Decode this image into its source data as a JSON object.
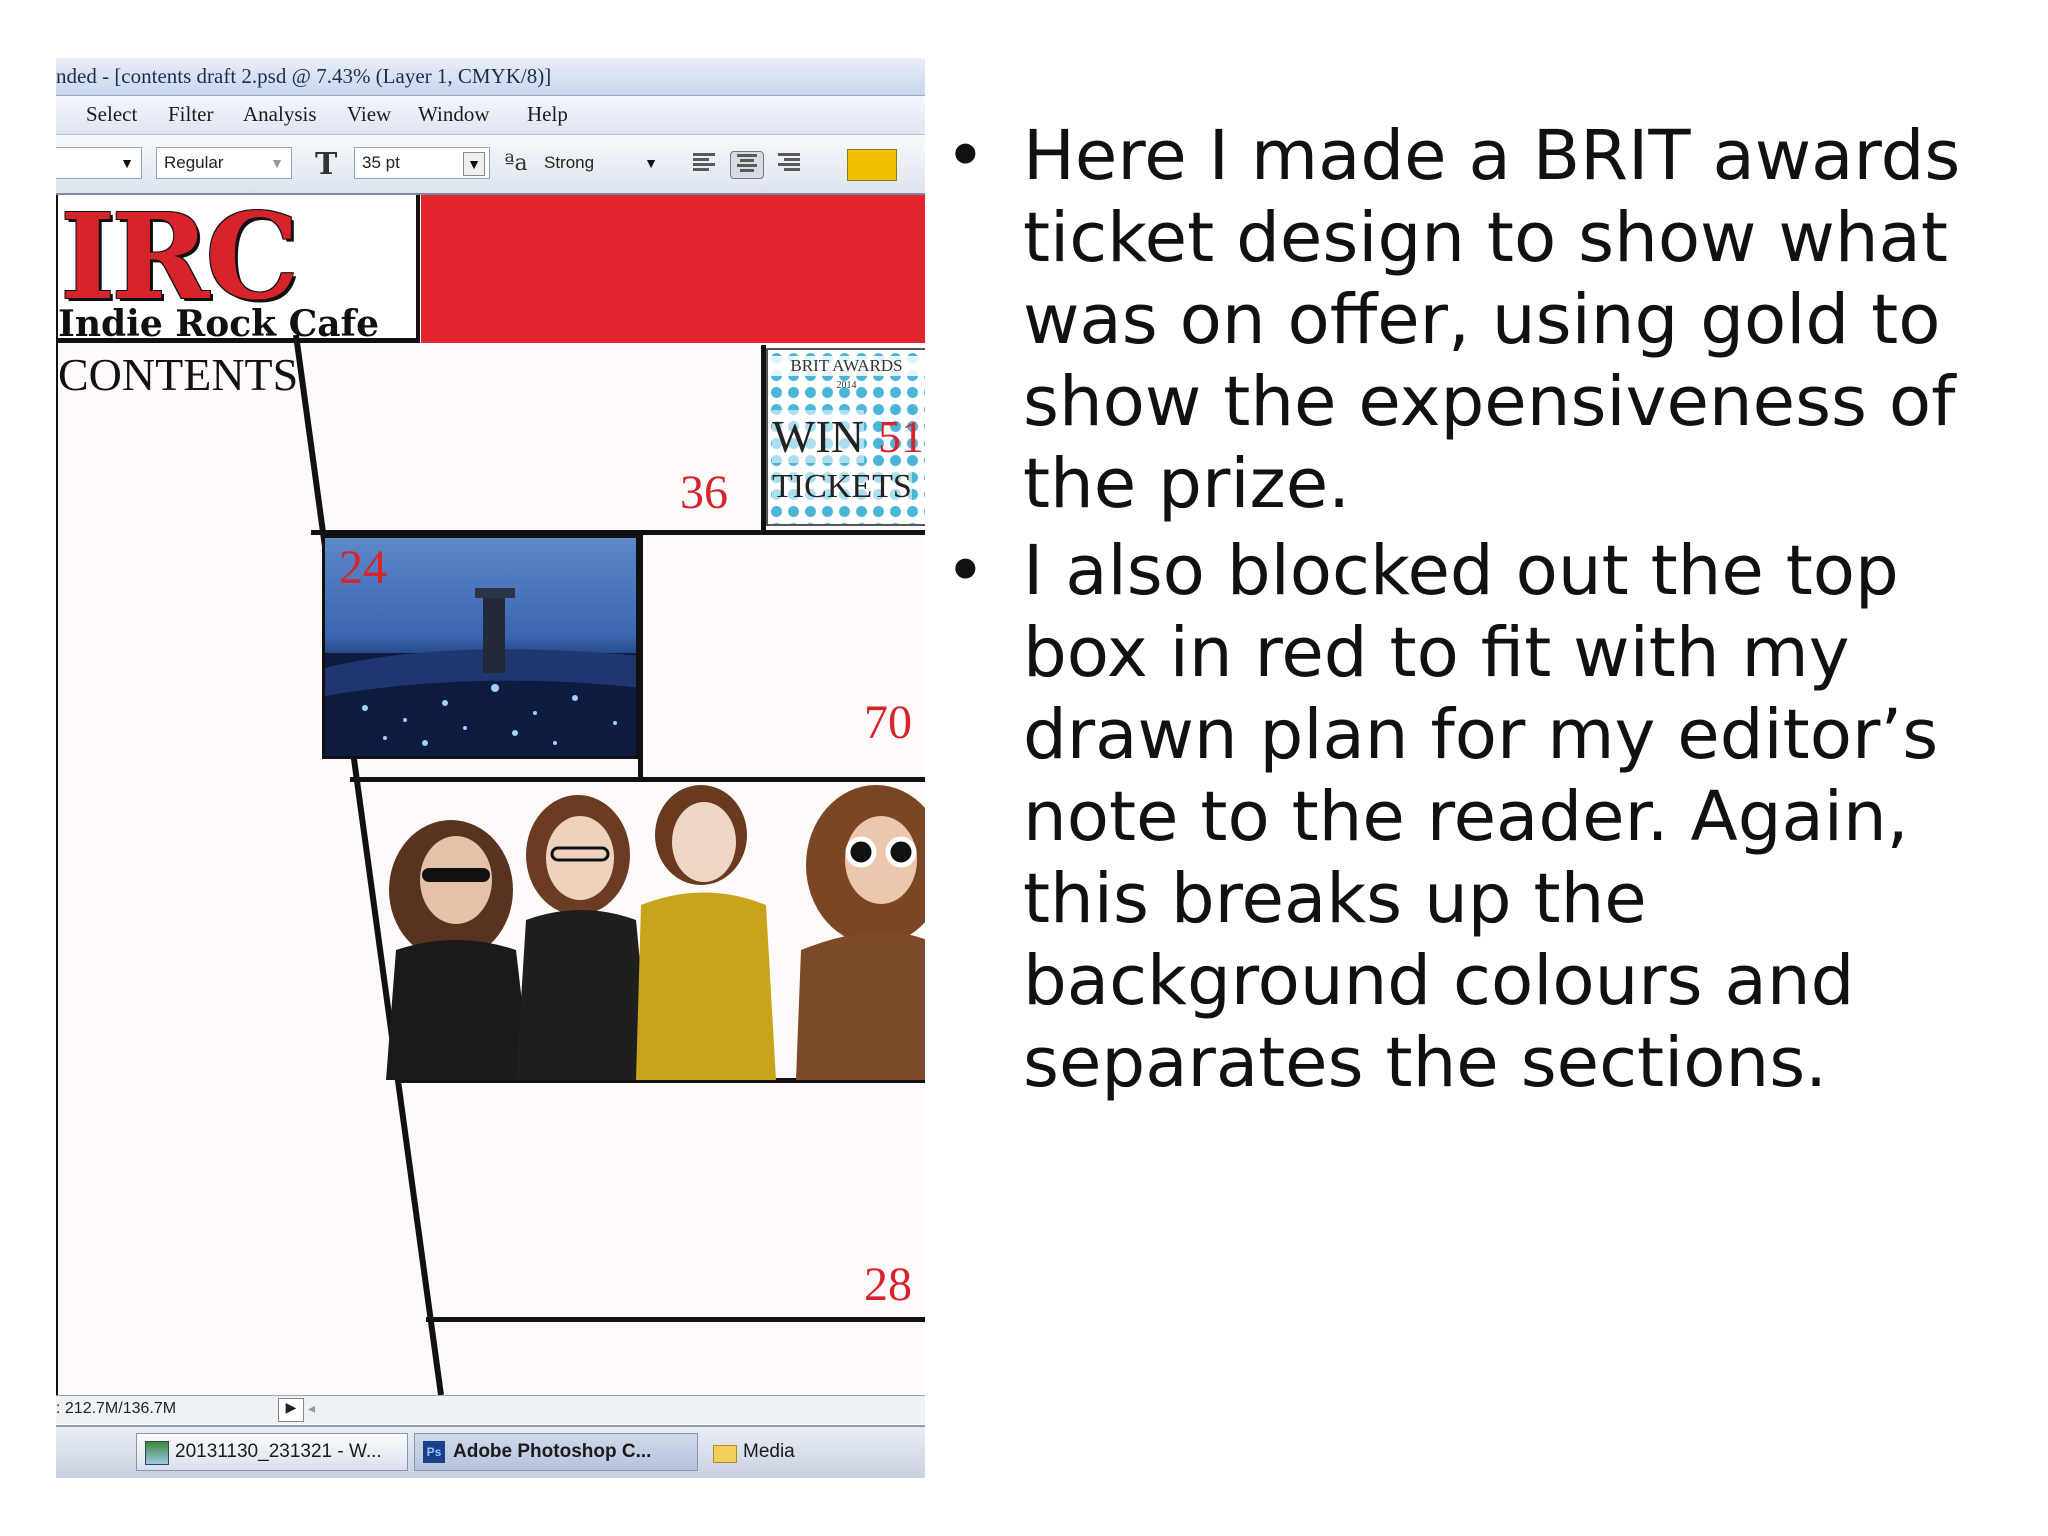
{
  "window": {
    "title": "nded - [contents draft 2.psd @ 7.43% (Layer 1, CMYK/8)]"
  },
  "menu": {
    "items": [
      "Select",
      "Filter",
      "Analysis",
      "View",
      "Window",
      "Help"
    ]
  },
  "options_bar": {
    "font_style": "Regular",
    "font_size": "35 pt",
    "anti_alias": "Strong",
    "text_color": "#f2c200"
  },
  "canvas": {
    "logo_text": "IRC",
    "logo_subtitle": "Indie Rock Cafe",
    "contents_heading": "CONTENTS",
    "page_numbers": {
      "p36": "36",
      "p24": "24",
      "p70": "70",
      "p28": "28"
    },
    "brit": {
      "title": "BRIT AWARDS",
      "year": "2014",
      "win": "WIN",
      "page": "51",
      "tickets": "TICKETS"
    },
    "colors": {
      "red_banner": "#e4252d",
      "page_number_red": "#d6232c",
      "brit_dots": "#49b6d8"
    }
  },
  "status_bar": {
    "doc_size": ": 212.7M/136.7M"
  },
  "taskbar": {
    "items": [
      {
        "label": "20131130_231321 - W...",
        "icon": "image-viewer-icon"
      },
      {
        "label": "Adobe Photoshop C...",
        "icon": "photoshop-icon"
      },
      {
        "label": "Media",
        "icon": "folder-icon"
      }
    ]
  },
  "bullets": [
    "Here I made a BRIT awards ticket design to show what was on offer, using gold to show the expensiveness of the prize.",
    "I also blocked out the top box in red to fit with my drawn plan for my editor’s note to the reader. Again, this breaks up the background colours and separates the sections."
  ]
}
